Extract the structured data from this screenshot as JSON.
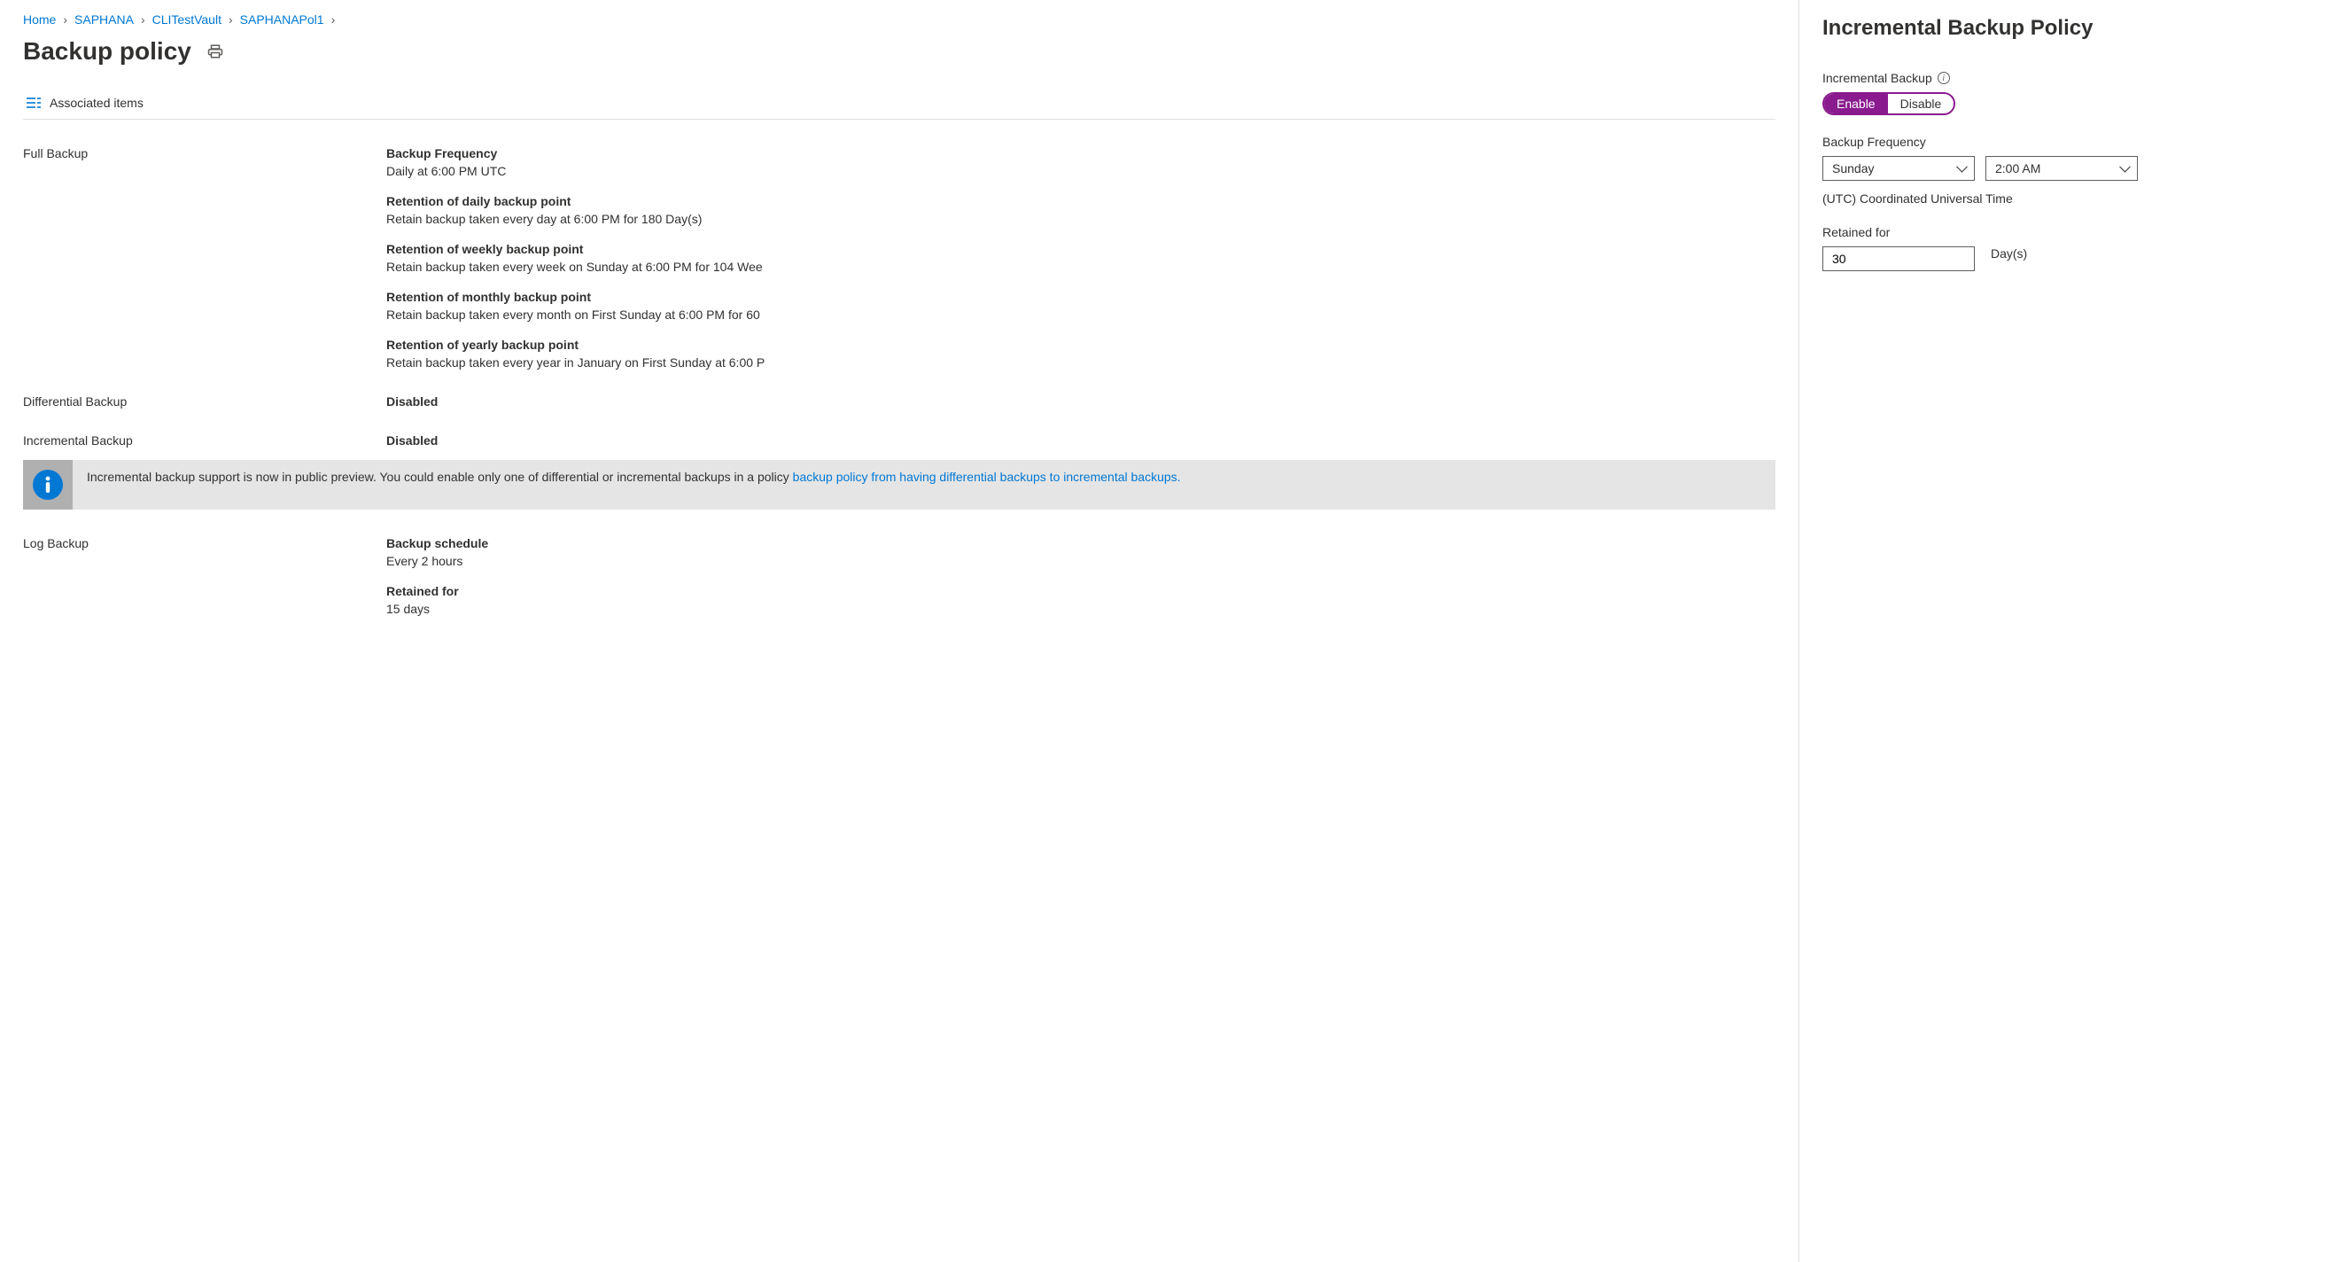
{
  "breadcrumb": {
    "items": [
      {
        "label": "Home"
      },
      {
        "label": "SAPHANA"
      },
      {
        "label": "CLITestVault"
      },
      {
        "label": "SAPHANAPol1"
      }
    ]
  },
  "page_title": "Backup policy",
  "associated_items_label": "Associated items",
  "full_backup": {
    "label": "Full Backup",
    "frequency": {
      "label": "Backup Frequency",
      "value": "Daily at 6:00 PM UTC"
    },
    "daily": {
      "label": "Retention of daily backup point",
      "value": "Retain backup taken every day at 6:00 PM for 180 Day(s)"
    },
    "weekly": {
      "label": "Retention of weekly backup point",
      "value": "Retain backup taken every week on Sunday at 6:00 PM for 104 Wee"
    },
    "monthly": {
      "label": "Retention of monthly backup point",
      "value": "Retain backup taken every month on First Sunday at 6:00 PM for 60"
    },
    "yearly": {
      "label": "Retention of yearly backup point",
      "value": "Retain backup taken every year in January on First Sunday at 6:00 P"
    }
  },
  "differential_backup": {
    "label": "Differential Backup",
    "value": "Disabled"
  },
  "incremental_backup_row": {
    "label": "Incremental Backup",
    "value": "Disabled"
  },
  "info_banner": {
    "text": "Incremental backup support is now in public preview. You could enable only one of differential or incremental backups in a policy ",
    "link": "backup policy from having differential backups to incremental backups."
  },
  "log_backup": {
    "label": "Log Backup",
    "schedule": {
      "label": "Backup schedule",
      "value": "Every 2 hours"
    },
    "retained": {
      "label": "Retained for",
      "value": "15 days"
    }
  },
  "side": {
    "title": "Incremental Backup Policy",
    "incremental_label": "Incremental Backup",
    "enable_label": "Enable",
    "disable_label": "Disable",
    "frequency_label": "Backup Frequency",
    "day_value": "Sunday",
    "time_value": "2:00 AM",
    "tz_text": "(UTC) Coordinated Universal Time",
    "retained_label": "Retained for",
    "retained_value": "30",
    "retained_unit": "Day(s)"
  }
}
